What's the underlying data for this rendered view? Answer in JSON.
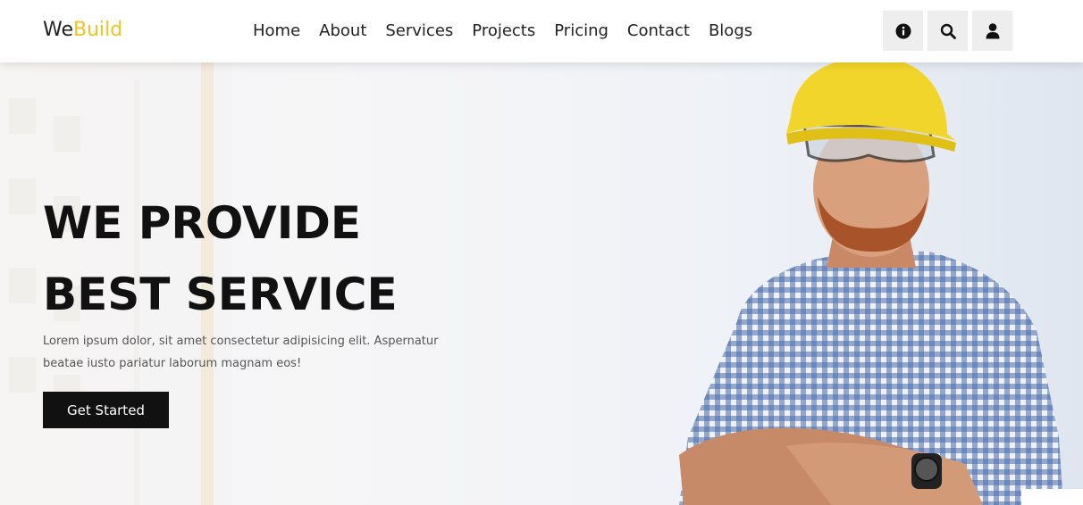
{
  "brand": {
    "prefix": "We",
    "accent": "Build",
    "accent_color": "#f3c323"
  },
  "nav": {
    "items": [
      {
        "label": "Home"
      },
      {
        "label": "About"
      },
      {
        "label": "Services"
      },
      {
        "label": "Projects"
      },
      {
        "label": "Pricing"
      },
      {
        "label": "Contact"
      },
      {
        "label": "Blogs"
      }
    ]
  },
  "header_icons": [
    "info-icon",
    "search-icon",
    "user-icon"
  ],
  "hero": {
    "title_line1": "WE PROVIDE",
    "title_line2": "BEST SERVICE",
    "description_line1": "Lorem ipsum dolor, sit amet consectetur adipisicing elit. Aspernatur",
    "description_line2": "beatae iusto pariatur laborum magnam eos!",
    "cta_label": "Get Started",
    "image": "construction-worker-photo"
  }
}
